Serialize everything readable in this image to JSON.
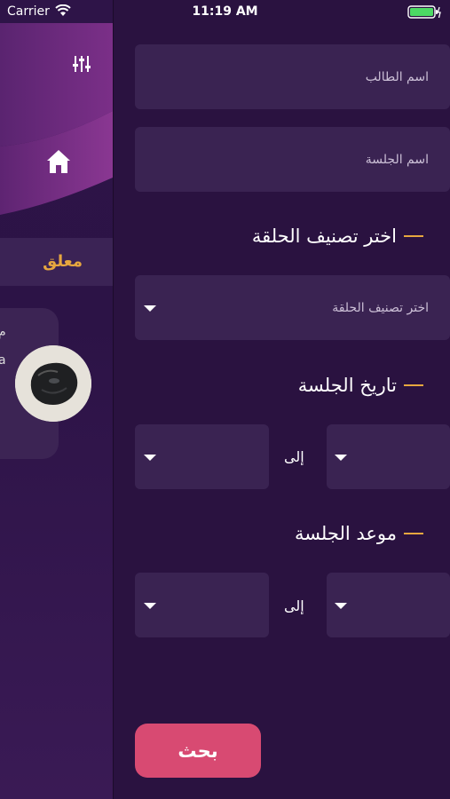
{
  "status_bar": {
    "carrier": "Carrier",
    "time": "11:19 AM"
  },
  "drawer": {
    "active_tab": "معلق",
    "card_line1": "م",
    "card_line2": "a"
  },
  "form": {
    "student_name_placeholder": "اسم الطالب",
    "session_name_placeholder": "اسم الجلسة",
    "category_heading": "اختر تصنيف الحلقة",
    "category_select_placeholder": "اختر تصنيف الحلقة",
    "date_heading": "تاريخ الجلسة",
    "time_heading": "موعد الجلسة",
    "to_label": "إلى",
    "search_button": "بحث"
  },
  "colors": {
    "accent": "#e7a73f",
    "button": "#d84a72",
    "background": "#2a1240",
    "field": "#3a2352"
  },
  "icons": [
    "wifi-icon",
    "battery-icon",
    "filter-sliders-icon",
    "home-icon",
    "dropdown-arrow-icon"
  ]
}
